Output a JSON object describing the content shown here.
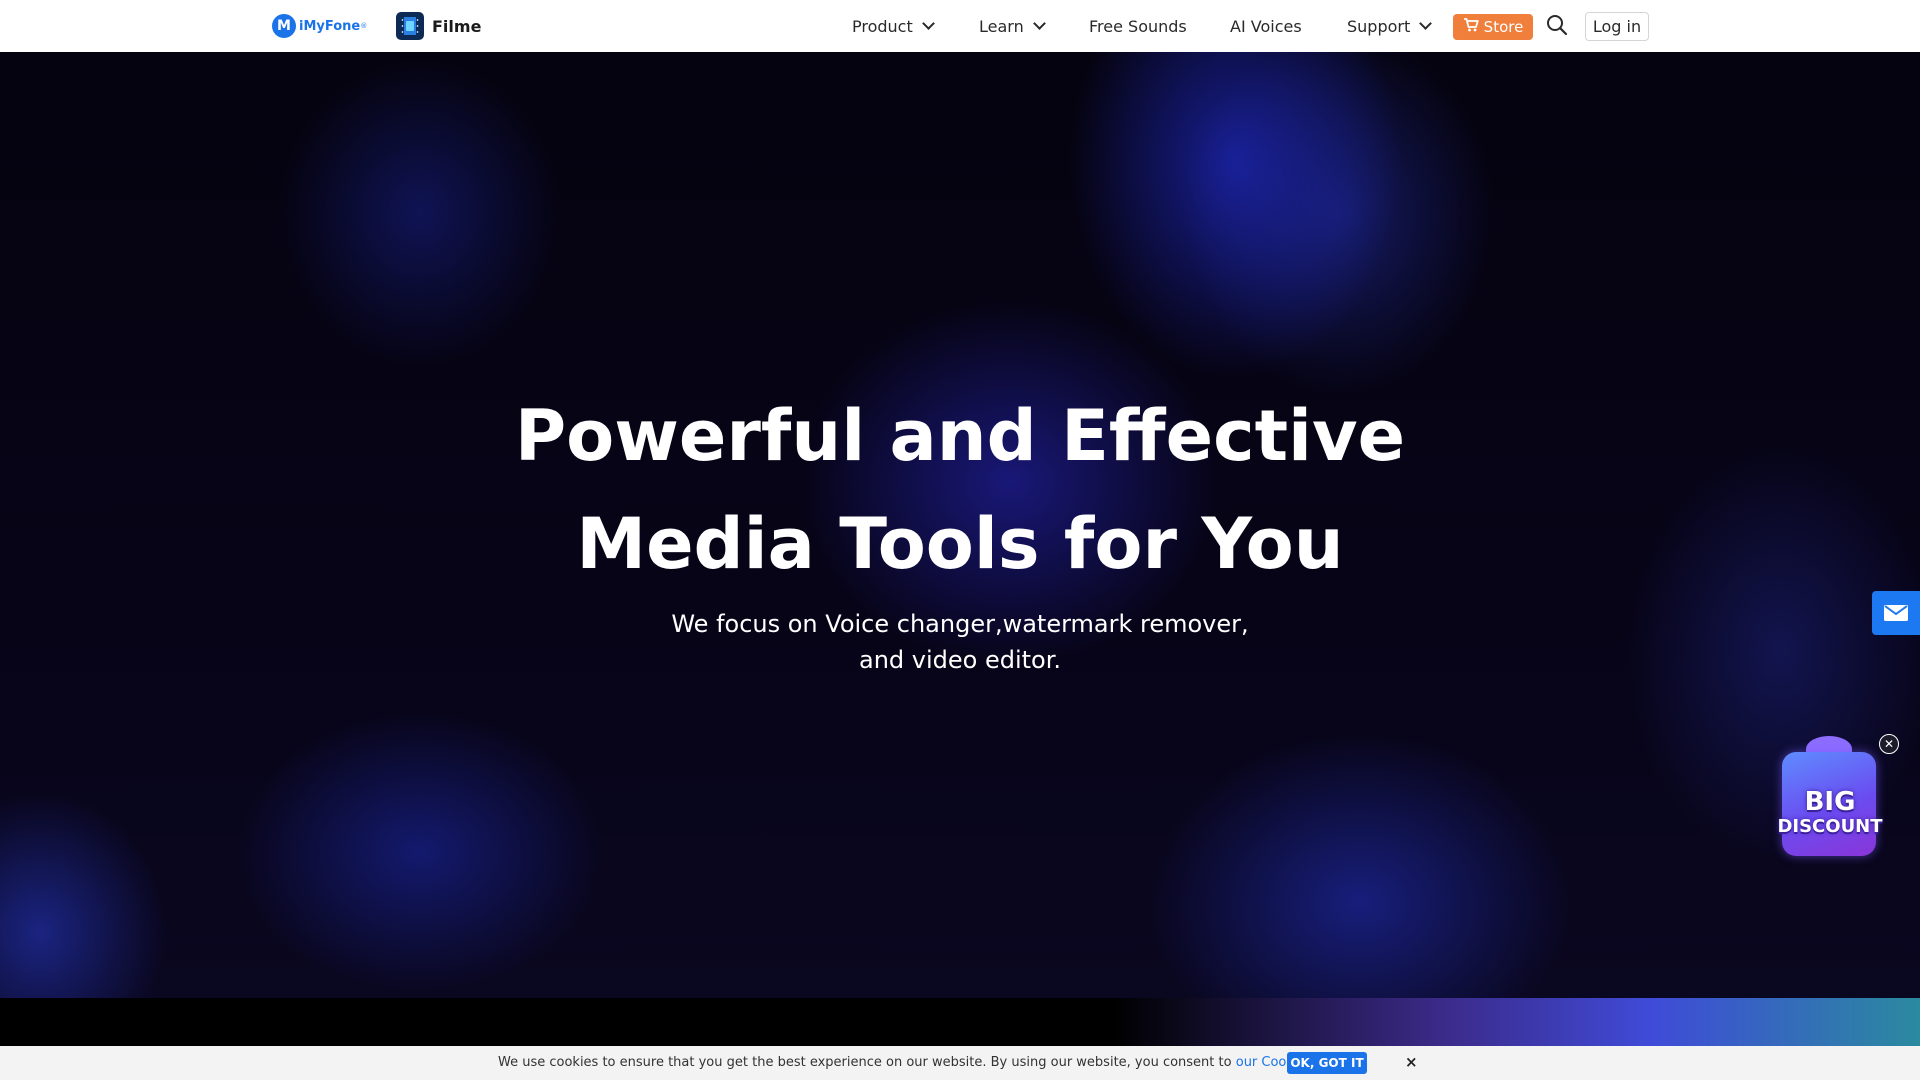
{
  "header": {
    "brand": {
      "name": "iMyFone",
      "badge": "M",
      "registered": "®"
    },
    "product": {
      "name": "Filme"
    },
    "nav": [
      {
        "label": "Product",
        "dropdown": true
      },
      {
        "label": "Learn",
        "dropdown": true
      },
      {
        "label": "Free Sounds",
        "dropdown": false
      },
      {
        "label": "AI Voices",
        "dropdown": false
      },
      {
        "label": "Support",
        "dropdown": true
      }
    ],
    "store_label": "Store",
    "login_label": "Log in"
  },
  "hero": {
    "title_line1": "Powerful and Effective",
    "title_line2": "Media Tools for You",
    "subtitle_line1": "We focus on Voice changer,watermark remover,",
    "subtitle_line2": "and video editor."
  },
  "promo": {
    "line1": "BIG",
    "line2": "DISCOUNT"
  },
  "cookie": {
    "text": "We use cookies to ensure that you get the best experience on our website. By using our website, you consent to",
    "link": "our Cookies Policy",
    "period": ".",
    "ok_label": "OK, GOT IT",
    "close_label": "×"
  },
  "colors": {
    "accent": "#1a73e8",
    "store": "#f07f3c",
    "hero_bg": "#05030f"
  },
  "icons": {
    "search": "search-icon",
    "mail": "mail-icon",
    "cart": "cart-icon",
    "chevron": "chevron-down-icon",
    "close": "close-icon"
  }
}
